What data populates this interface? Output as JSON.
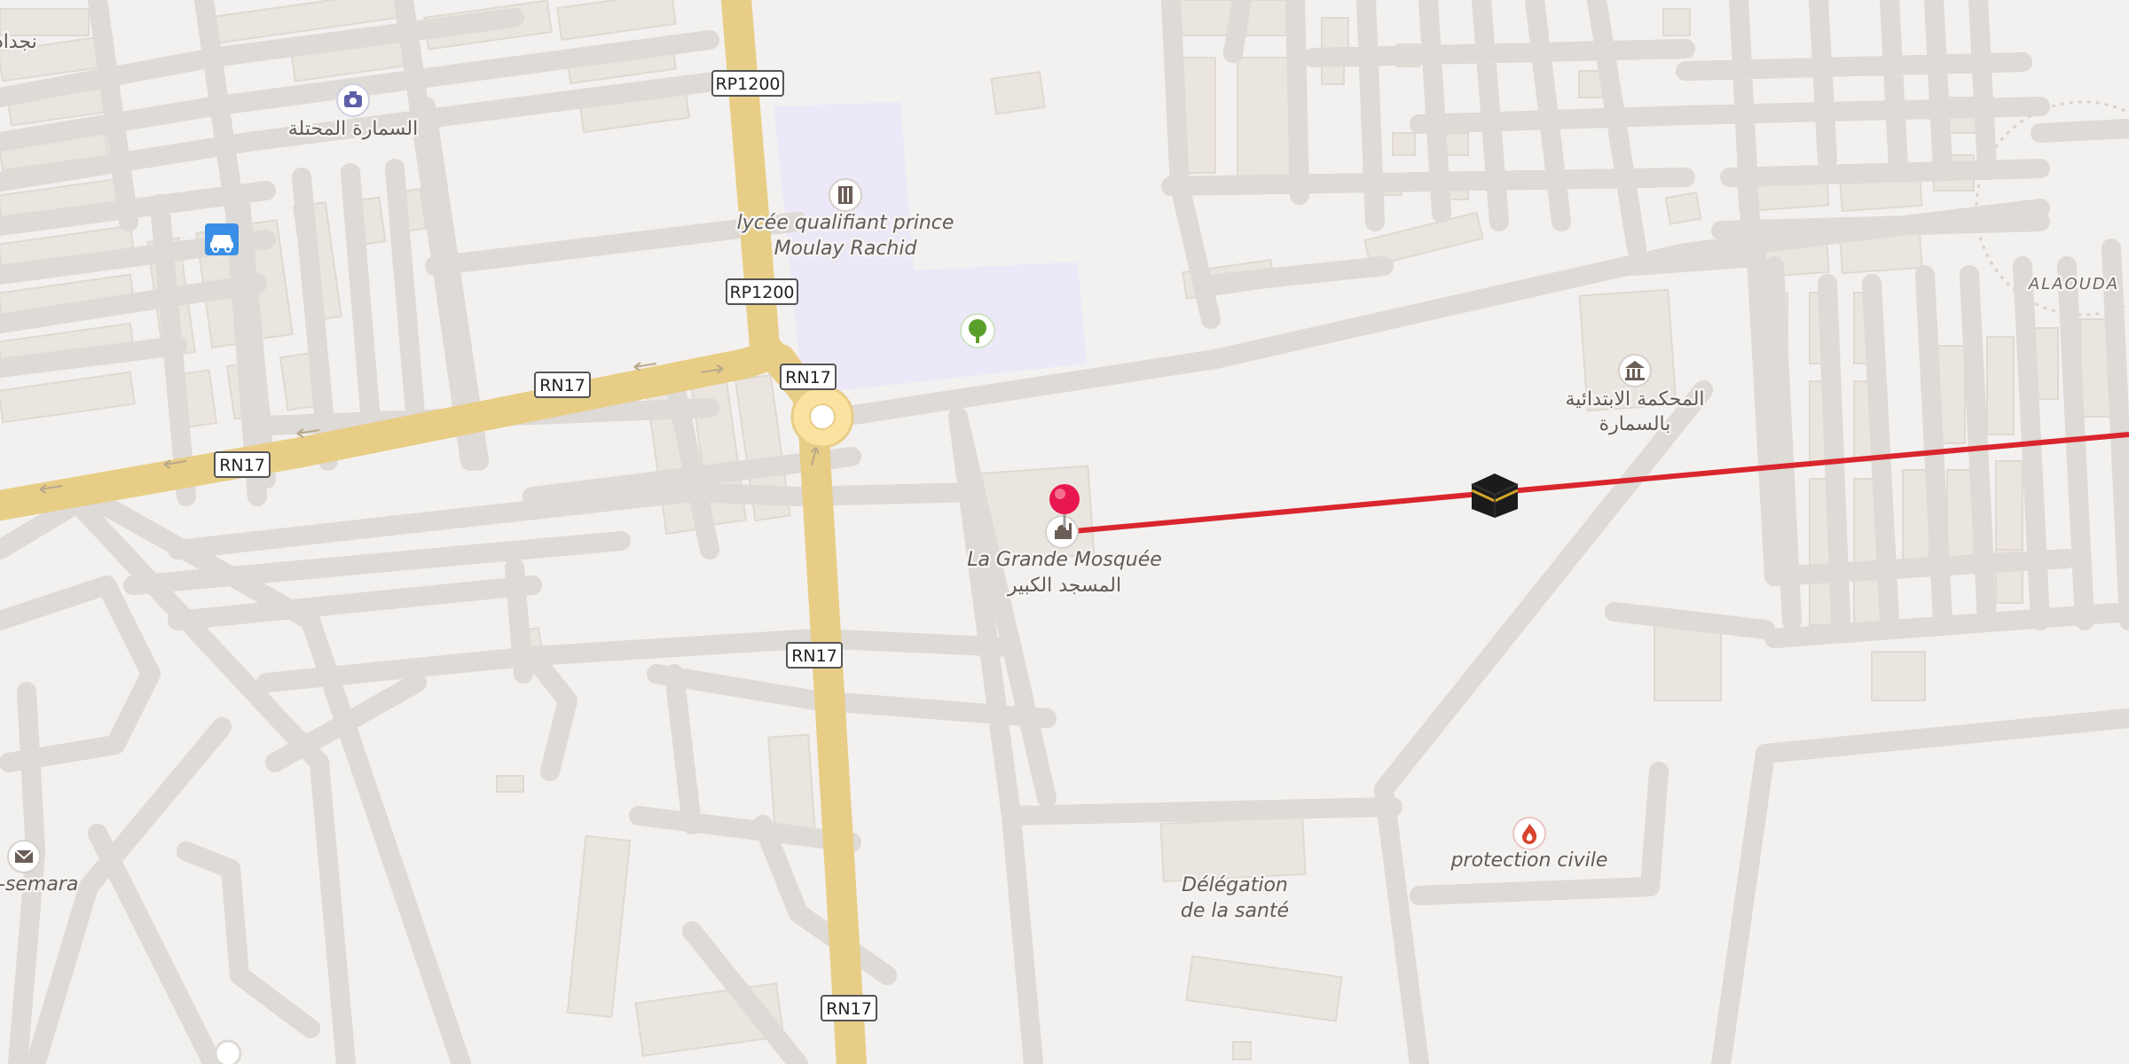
{
  "map": {
    "district": "ALAOUDA",
    "pois": {
      "camera_ar": "السمارة المحتلة",
      "school_line1": "lycée qualifiant prince",
      "school_line2": "Moulay Rachid",
      "mosque_fr": "La Grande Mosquée",
      "mosque_ar": "المسجد الكبير",
      "court_line1": "المحكمة الابتدائية",
      "court_line2": "بالسمارة",
      "health_line1": "Délégation",
      "health_line2": "de la santé",
      "civil_protection": "protection civile",
      "post_partial": "-semara",
      "topleft_partial": "نجداد"
    },
    "road_shields": {
      "rp1200_a": "RP1200",
      "rp1200_b": "RP1200",
      "rn17_a": "RN17",
      "rn17_b": "RN17",
      "rn17_c": "RN17",
      "rn17_d": "RN17",
      "rn17_e": "RN17"
    },
    "colors": {
      "background": "#f3f1ef",
      "school_area": "#ece8f7",
      "main_road": "#fbe2a0",
      "qibla_line": "#d9262e",
      "pin": "#e8174f"
    },
    "icons": {
      "camera": "camera-icon",
      "car": "car-icon",
      "school": "school-icon",
      "tree": "tree-icon",
      "mosque": "mosque-icon",
      "kaaba": "kaaba-icon",
      "court": "courthouse-icon",
      "fire": "fire-station-icon",
      "mail": "mail-icon",
      "pin": "location-pin-icon"
    }
  }
}
